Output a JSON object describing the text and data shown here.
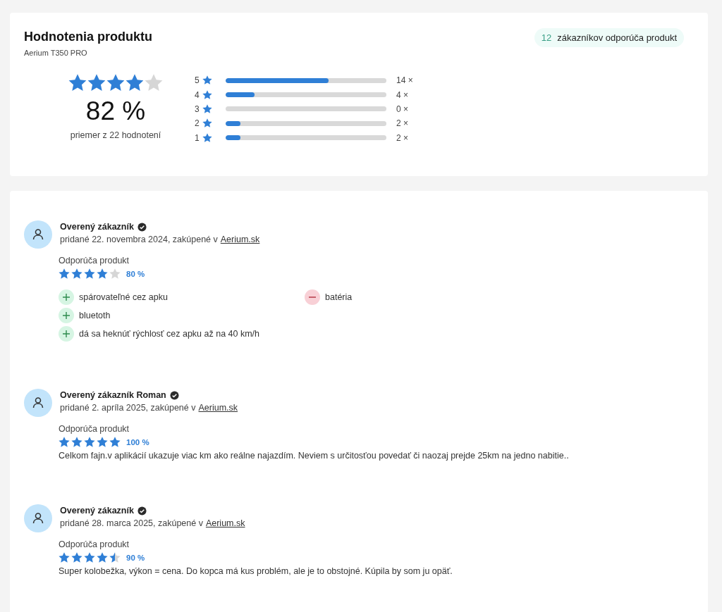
{
  "summary": {
    "title": "Hodnotenia produktu",
    "product": "Aerium T350 PRO",
    "recommend_count": "12",
    "recommend_text": "zákazníkov odporúča produkt",
    "stars": 4,
    "percent": "82 %",
    "average_text": "priemer z 22 hodnotení",
    "distribution": [
      {
        "label": "5",
        "level": 0.64,
        "count": "14 ×"
      },
      {
        "label": "4",
        "level": 0.18,
        "count": "4 ×"
      },
      {
        "label": "3",
        "count": "0 ×"
      },
      {
        "label": "2",
        "level": 0.09,
        "count": "2 ×"
      },
      {
        "label": "1",
        "level": 0.09,
        "count": "2 ×"
      }
    ]
  },
  "reviews": [
    {
      "author": "Overený zákazník",
      "verified": true,
      "meta": "pridané 22. novembra 2024, zakúpené v",
      "shop_link": "Aerium.sk",
      "recommend_label": "Odporúča produkt",
      "stars": 4,
      "percent": "80 %",
      "pros": [
        "spárovateľné cez apku",
        "bluetoth",
        "dá sa heknúť rýchlosť cez apku až na 40 km/h"
      ],
      "cons": [
        "batéria"
      ]
    },
    {
      "author": "Overený zákazník Roman",
      "verified": true,
      "meta": "pridané 2. apríla 2025, zakúpené v",
      "shop_link": "Aerium.sk",
      "recommend_label": "Odporúča produkt",
      "stars": 5,
      "percent": "100 %",
      "text": "Celkom fajn.v aplikácií ukazuje viac km ako reálne najazdím. Neviem s určitosťou povedať či naozaj prejde 25km na jedno nabitie.."
    },
    {
      "author": "Overený zákazník",
      "verified": true,
      "meta": "pridané 28. marca 2025, zakúpené v",
      "shop_link": "Aerium.sk",
      "recommend_label": "Odporúča produkt",
      "stars": 4.5,
      "percent": "90 %",
      "text": "Super kolobežka, výkon = cena. Do kopca má kus problém, ale je to obstojné. Kúpila by som ju opäť."
    }
  ]
}
